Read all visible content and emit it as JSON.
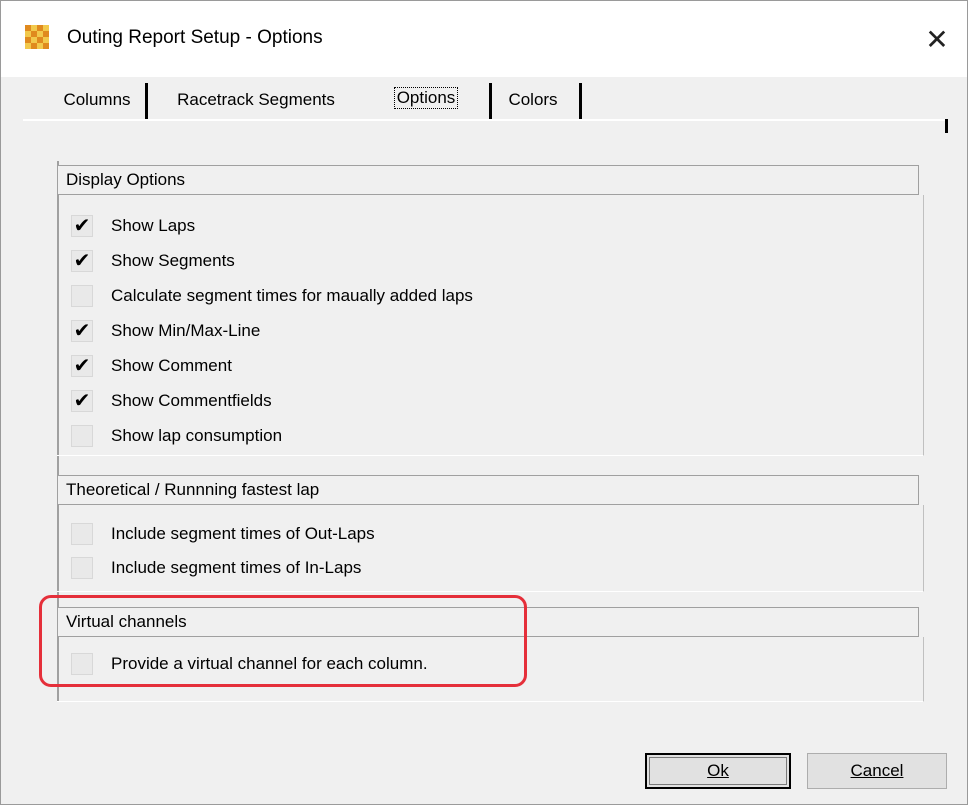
{
  "window": {
    "title": "Outing Report Setup - Options"
  },
  "icons": {
    "app": "racing-flag-icon",
    "close": "close-icon",
    "check": "checkmark-icon"
  },
  "tabs": [
    {
      "label": "Columns",
      "active": false
    },
    {
      "label": "Racetrack Segments",
      "active": false
    },
    {
      "label": "Options",
      "active": true
    },
    {
      "label": "Colors",
      "active": false
    }
  ],
  "groups": {
    "display": {
      "header": "Display Options",
      "items": [
        {
          "label": "Show Laps",
          "checked": true
        },
        {
          "label": "Show Segments",
          "checked": true
        },
        {
          "label": "Calculate segment times for maually added laps",
          "checked": false
        },
        {
          "label": "Show Min/Max-Line",
          "checked": true
        },
        {
          "label": "Show Comment",
          "checked": true
        },
        {
          "label": "Show Commentfields",
          "checked": true
        },
        {
          "label": "Show lap consumption",
          "checked": false
        }
      ]
    },
    "theoretical": {
      "header": "Theoretical / Runnning fastest lap",
      "items": [
        {
          "label": "Include segment times of Out-Laps",
          "checked": false
        },
        {
          "label": "Include segment times of In-Laps",
          "checked": false
        }
      ]
    },
    "virtual": {
      "header": "Virtual channels",
      "items": [
        {
          "label": "Provide a virtual channel for each column.",
          "checked": false
        }
      ]
    }
  },
  "buttons": {
    "ok": "Ok",
    "cancel": "Cancel"
  },
  "colors": {
    "highlight": "#e52f3a",
    "dialog_bg": "#f0f0f0"
  }
}
